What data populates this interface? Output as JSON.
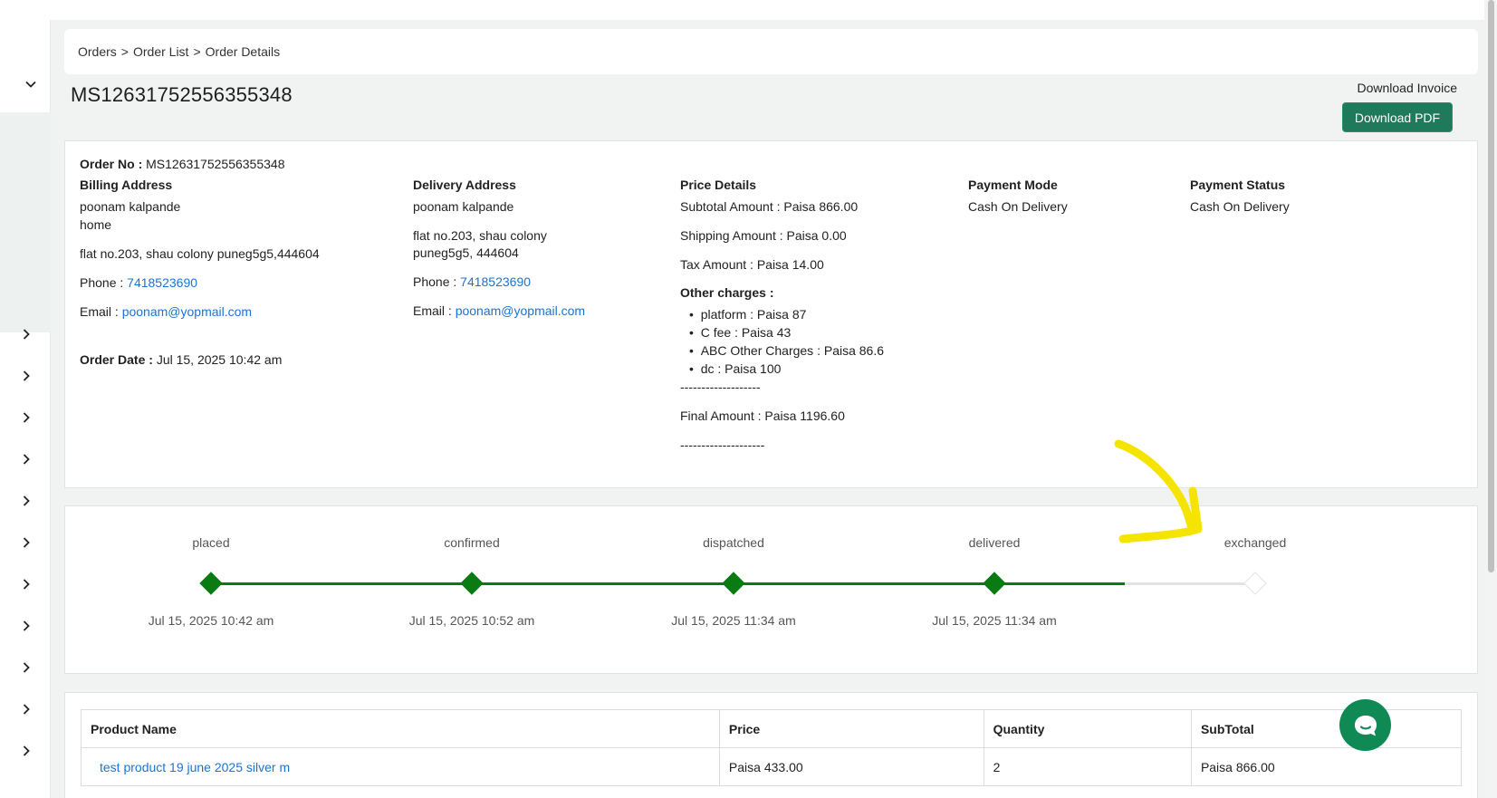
{
  "sidebar": {
    "expand_icon": "chevron-down-icon",
    "nav_icon": "chevron-right-icon"
  },
  "breadcrumb": {
    "items": [
      "Orders",
      "Order List",
      "Order Details"
    ],
    "separator": ">"
  },
  "order": {
    "id": "MS12631752556355348"
  },
  "invoice": {
    "label": "Download Invoice",
    "button": "Download PDF"
  },
  "details": {
    "order_no_label": "Order No :",
    "order_no": "MS12631752556355348",
    "billing": {
      "title": "Billing Address",
      "name": "poonam kalpande",
      "type": "home",
      "address": "flat no.203, shau colony puneg5g5,444604",
      "phone_label": "Phone :",
      "phone": "7418523690",
      "email_label": "Email :",
      "email": "poonam@yopmail.com"
    },
    "order_date_label": "Order Date :",
    "order_date": "Jul 15, 2025 10:42 am",
    "delivery": {
      "title": "Delivery Address",
      "name": "poonam kalpande",
      "address_line1": "flat no.203, shau colony",
      "address_line2": "puneg5g5, 444604",
      "phone_label": "Phone :",
      "phone": "7418523690",
      "email_label": "Email :",
      "email": "poonam@yopmail.com"
    },
    "price": {
      "title": "Price Details",
      "subtotal": "Subtotal Amount : Paisa 866.00",
      "shipping": "Shipping Amount : Paisa 0.00",
      "tax": "Tax Amount : Paisa  14.00",
      "other_title": "Other charges :",
      "other_charges": [
        "platform :  Paisa  87",
        "C fee :  Paisa  43",
        "ABC Other Charges :  Paisa  86.6",
        "dc :  Paisa  100"
      ],
      "divider1": "-------------------",
      "final": "Final Amount : Paisa  1196.60",
      "divider2": "--------------------"
    },
    "payment_mode": {
      "title": "Payment Mode",
      "value": "Cash On Delivery"
    },
    "payment_status": {
      "title": "Payment Status",
      "value": "Cash On Delivery"
    }
  },
  "tracker": {
    "steps": [
      {
        "label": "placed",
        "time": "Jul 15, 2025 10:42 am",
        "done": true
      },
      {
        "label": "confirmed",
        "time": "Jul 15, 2025 10:52 am",
        "done": true
      },
      {
        "label": "dispatched",
        "time": "Jul 15, 2025 11:34 am",
        "done": true
      },
      {
        "label": "delivered",
        "time": "Jul 15, 2025 11:34 am",
        "done": true
      },
      {
        "label": "exchanged",
        "time": "",
        "done": false
      }
    ],
    "done_color": "#0a7a12",
    "pending_color": "#e3e3e3"
  },
  "products": {
    "headers": [
      "Product Name",
      "Price",
      "Quantity",
      "SubTotal"
    ],
    "rows": [
      {
        "name": "test product 19 june 2025 silver m",
        "price": "Paisa 433.00",
        "quantity": "2",
        "subtotal": "Paisa 866.00"
      }
    ]
  },
  "annotation": {
    "color": "#f5e400"
  },
  "chat": {
    "icon": "chat-bubble-icon"
  },
  "colors": {
    "brand_green": "#1f7a5c",
    "link": "#1a73d9"
  }
}
